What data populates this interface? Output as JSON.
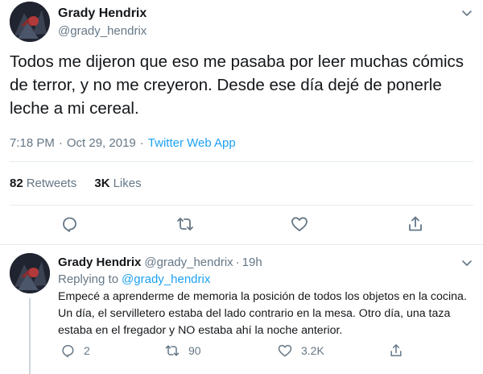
{
  "main_tweet": {
    "author": {
      "name": "Grady Hendrix",
      "handle": "@grady_hendrix"
    },
    "text": "Todos me dijeron que eso me pasaba por leer muchas cómics de terror, y no me creyeron. Desde ese día dejé de ponerle leche a mi cereal.",
    "time": "7:18 PM",
    "date": "Oct 29, 2019",
    "separator": "·",
    "source": "Twitter Web App",
    "retweets": {
      "count": "82",
      "label": "Retweets"
    },
    "likes": {
      "count": "3K",
      "label": "Likes"
    },
    "actions": [
      "reply-icon",
      "retweet-icon",
      "like-icon",
      "share-icon"
    ]
  },
  "reply_tweet": {
    "author": {
      "name": "Grady Hendrix",
      "handle": "@grady_hendrix"
    },
    "dot": "·",
    "time_ago": "19h",
    "replying_label": "Replying to",
    "replying_to": "@grady_hendrix",
    "text": "Empecé a aprenderme de memoria la posición de todos los objetos en la cocina. Un día, el servilletero estaba del lado contrario en la mesa. Otro día, una taza estaba en el fregador y NO estaba ahí la noche anterior.",
    "reply_count": "2",
    "retweet_count": "90",
    "like_count": "3.2K",
    "actions": [
      "reply-icon",
      "retweet-icon",
      "like-icon",
      "share-icon"
    ]
  },
  "colors": {
    "text": "#14171a",
    "secondary": "#657786",
    "accent": "#1da1f2",
    "divider": "#e6ecf0"
  }
}
